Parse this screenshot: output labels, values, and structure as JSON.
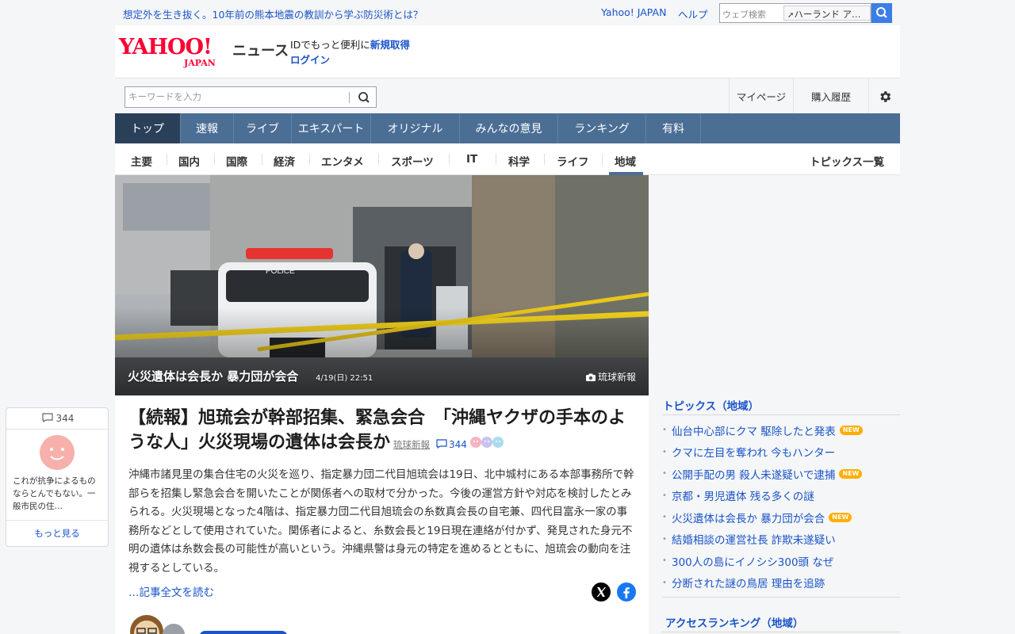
{
  "topbar": {
    "headline": "想定外を生き抜く。10年前の熊本地震の教訓から学ぶ防災術とは？",
    "yahoo_japan": "Yahoo! JAPAN",
    "help": "ヘルプ",
    "web_search_placeholder": "ウェブ検索",
    "search_suggestion": "ハーランド ア…"
  },
  "masthead": {
    "logo_yahoo": "YAHOO!",
    "logo_japan": "JAPAN",
    "logo_news": "ニュース",
    "id_prompt": "IDでもっと便利に",
    "signup": "新規取得",
    "login": "ログイン"
  },
  "search": {
    "placeholder": "キーワードを入力"
  },
  "util_nav": {
    "mypage": "マイページ",
    "history": "購入履歴"
  },
  "main_tabs": [
    {
      "label": "トップ",
      "active": true
    },
    {
      "label": "速報"
    },
    {
      "label": "ライブ"
    },
    {
      "label": "エキスパート"
    },
    {
      "label": "オリジナル"
    },
    {
      "label": "みんなの意見"
    },
    {
      "label": "ランキング"
    },
    {
      "label": "有料"
    }
  ],
  "sub_tabs": [
    {
      "label": "主要"
    },
    {
      "label": "国内"
    },
    {
      "label": "国際"
    },
    {
      "label": "経済"
    },
    {
      "label": "エンタメ"
    },
    {
      "label": "スポーツ"
    },
    {
      "label": "IT"
    },
    {
      "label": "科学"
    },
    {
      "label": "ライフ"
    },
    {
      "label": "地域",
      "active": true
    }
  ],
  "topics_list_link": "トピックス一覧",
  "hero": {
    "caption": "火災遺体は会長か 暴力団が会合",
    "time": "4/19(日) 22:51",
    "credit": "琉球新報"
  },
  "article": {
    "title": "【続報】旭琉会が幹部招集、緊急会合　「沖縄ヤクザの手本のような人」火災現場の遺体は会長か",
    "source": "琉球新報",
    "comment_count": "344",
    "body": "沖縄市諸見里の集合住宅の火災を巡り、指定暴力団二代目旭琉会は19日、北中城村にある本部事務所で幹部らを招集し緊急会合を開いたことが関係者への取材で分かった。今後の運営方針や対応を検討したとみられる。火災現場となった4階は、指定暴力団二代目旭琉会の糸数真会長の自宅兼、四代目富永一家の事務所などとして使用されていた。関係者によると、糸数会長と19日現在連絡が付かず、発見された身元不明の遺体は糸数会長の可能性が高いという。沖縄県警は身元の特定を進めるとともに、旭琉会の動向を注視するとしている。",
    "read_more": "…記事全文を読む"
  },
  "comment_widget": {
    "count": "344",
    "excerpt": "これが抗争によるものならとんでもない。一般市民の住…",
    "more": "もっと見る"
  },
  "right": {
    "topics_title": "トピックス（地域）",
    "new_label": "NEW",
    "topics": [
      {
        "text": "仙台中心部にクマ 駆除したと発表",
        "new": true
      },
      {
        "text": "クマに左目を奪われ 今もハンター",
        "new": false
      },
      {
        "text": "公開手配の男 殺人未遂疑いで逮捕",
        "new": true
      },
      {
        "text": "京都・男児遺体 残る多くの謎",
        "new": false
      },
      {
        "text": "火災遺体は会長か 暴力団が会合",
        "new": true
      },
      {
        "text": "結婚相談の運営社長 詐欺未遂疑い",
        "new": false
      },
      {
        "text": "300人の島にイノシシ300頭 なぜ",
        "new": false
      },
      {
        "text": "分断された謎の鳥居 理由を追跡",
        "new": false
      }
    ],
    "access_ranking_title": "アクセスランキング（地域）"
  },
  "colors": {
    "link_blue": "#1a54c9",
    "nav_blue": "#4b6e95",
    "nav_active": "#2a3f58",
    "brand_red": "#ff0033",
    "new_badge": "#ffae00"
  }
}
